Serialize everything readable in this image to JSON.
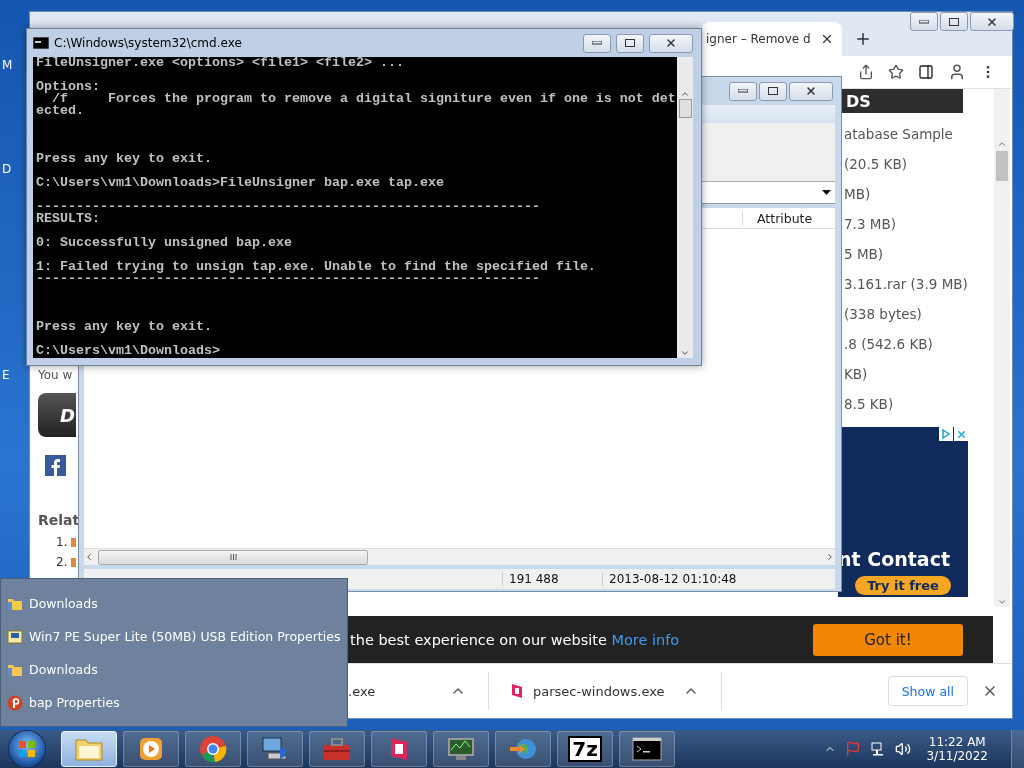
{
  "desktop": {
    "icon_labels": [
      "M",
      "D",
      "E"
    ]
  },
  "browser": {
    "tab": {
      "title": "igner – Remove d"
    },
    "page": {
      "left_column": {
        "intro": "You w",
        "download_button": "D",
        "related_heading": "Relat",
        "related_items": [
          "1.",
          "2."
        ]
      },
      "sidebar": {
        "heading": "DS",
        "items": [
          "atabase Sample",
          "(20.5 KB)",
          "MB)",
          "7.3 MB)",
          "5 MB)",
          "3.161.rar (3.9 MB)",
          "(338 bytes)",
          ".8 (542.6 KB)",
          "KB)",
          "8.5 KB)"
        ]
      },
      "ad": {
        "headline": "nt Contact",
        "button": "Try it free"
      }
    },
    "cookie_banner": {
      "message": "the best experience on our website",
      "link": "More info",
      "button": "Got it!"
    },
    "downloads": [
      {
        "name": ".exe",
        "kind": "plain"
      },
      {
        "name": "parsec-windows.exe",
        "kind": "parsec"
      }
    ],
    "show_all": "Show all"
  },
  "file_window": {
    "columns": [
      "Attribute"
    ],
    "status_bar": [
      "191 488",
      "2013-08-12 01:10:48"
    ]
  },
  "console": {
    "title": "C:\\Windows\\system32\\cmd.exe",
    "output": "FileUnsigner.exe <options> <file1> <file2> ...\n\nOptions:\n  /f     Forces the program to remove a digital signiture even if one is not det\nected.\n\n\n\nPress any key to exit.\n\nC:\\Users\\vm1\\Downloads>FileUnsigner bap.exe tap.exe\n\n---------------------------------------------------------------\nRESULTS:\n\n0: Successfully unsigned bap.exe\n\n1: Failed trying to unsign tap.exe. Unable to find the specified file.\n---------------------------------------------------------------\n\n\n\nPress any key to exit.\n\nC:\\Users\\vm1\\Downloads>"
  },
  "jump_list": {
    "items": [
      {
        "label": "Downloads",
        "kind": "folder"
      },
      {
        "label": "Win7 PE Super Lite (50MB) USB Edition Properties",
        "kind": "drive"
      },
      {
        "label": "Downloads",
        "kind": "folder"
      },
      {
        "label": "bap Properties",
        "kind": "app"
      }
    ]
  },
  "taskbar": {
    "apps": [
      {
        "kind": "explorer",
        "selected": true
      },
      {
        "kind": "media",
        "selected": false
      },
      {
        "kind": "chrome",
        "selected": false
      },
      {
        "kind": "network",
        "selected": false
      },
      {
        "kind": "toolbox",
        "selected": false
      },
      {
        "kind": "parsec",
        "selected": false
      },
      {
        "kind": "monitor",
        "selected": false
      },
      {
        "kind": "globe",
        "selected": false
      },
      {
        "kind": "sevenzip",
        "label": "7z",
        "selected": false
      },
      {
        "kind": "console",
        "selected": false
      }
    ],
    "clock": {
      "time": "11:22 AM",
      "date": "3/11/2022"
    }
  }
}
